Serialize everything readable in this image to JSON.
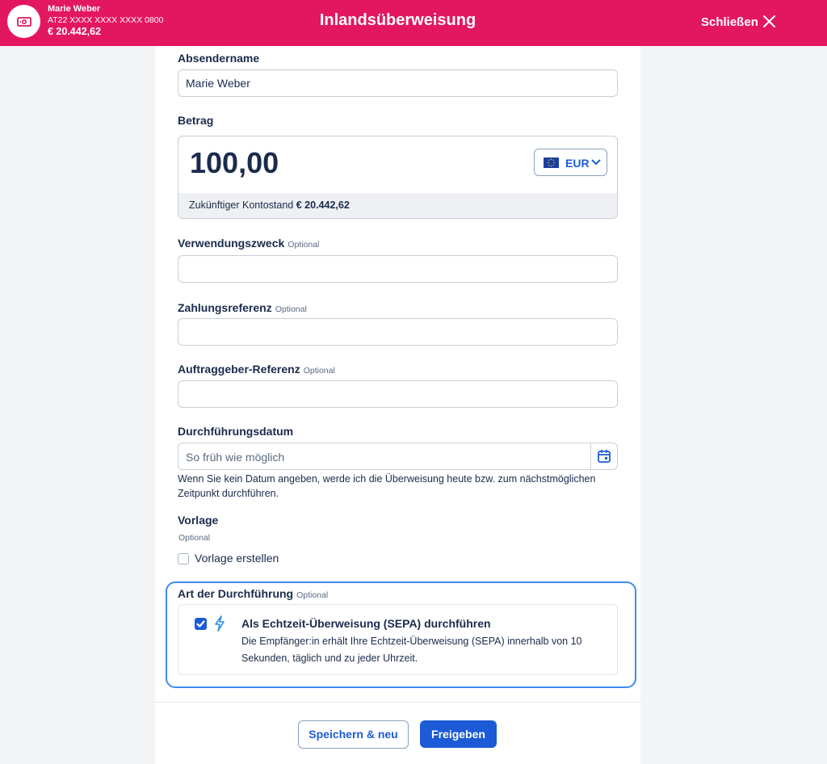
{
  "header": {
    "account_name": "Marie Weber",
    "account_iban": "AT22 XXXX XXXX XXXX 0800",
    "account_balance": "€ 20.442,62",
    "account_icon": "banknote-icon",
    "title": "Inlandsüberweisung",
    "close_label": "Schließen",
    "close_icon": "close-icon"
  },
  "sender": {
    "label": "Absendername",
    "value": "Marie Weber"
  },
  "amount": {
    "label": "Betrag",
    "value": "100,00",
    "currency": "EUR",
    "future_balance_label": "Zukünftiger Kontostand",
    "future_balance_value": "€ 20.442,62"
  },
  "purpose": {
    "label": "Verwendungszweck",
    "optional": "Optional",
    "value": ""
  },
  "payment_reference": {
    "label": "Zahlungsreferenz",
    "optional": "Optional",
    "value": ""
  },
  "orderer_reference": {
    "label": "Auftraggeber-Referenz",
    "optional": "Optional",
    "value": ""
  },
  "execution_date": {
    "label": "Durchführungsdatum",
    "placeholder": "So früh wie möglich",
    "hint": "Wenn Sie kein Datum angeben, werde ich die Überweisung heute bzw. zum nächstmöglichen Zeitpunkt durchführen."
  },
  "template": {
    "label": "Vorlage",
    "optional": "Optional",
    "checkbox_label": "Vorlage erstellen",
    "checked": false
  },
  "execution_type": {
    "label": "Art der Durchführung",
    "optional": "Optional",
    "option_title": "Als Echtzeit-Überweisung (SEPA) durchführen",
    "option_desc": "Die Empfänger:in erhält Ihre Echtzeit-Überweisung (SEPA) innerhalb von 10 Sekunden, täglich und zu jeder Uhrzeit.",
    "checked": true
  },
  "actions": {
    "save_new": "Speichern & neu",
    "release": "Freigeben"
  },
  "colors": {
    "brand": "#e3175f",
    "accent": "#1d5bd6",
    "text": "#1a2b4c",
    "focus": "#3f8bf0"
  }
}
